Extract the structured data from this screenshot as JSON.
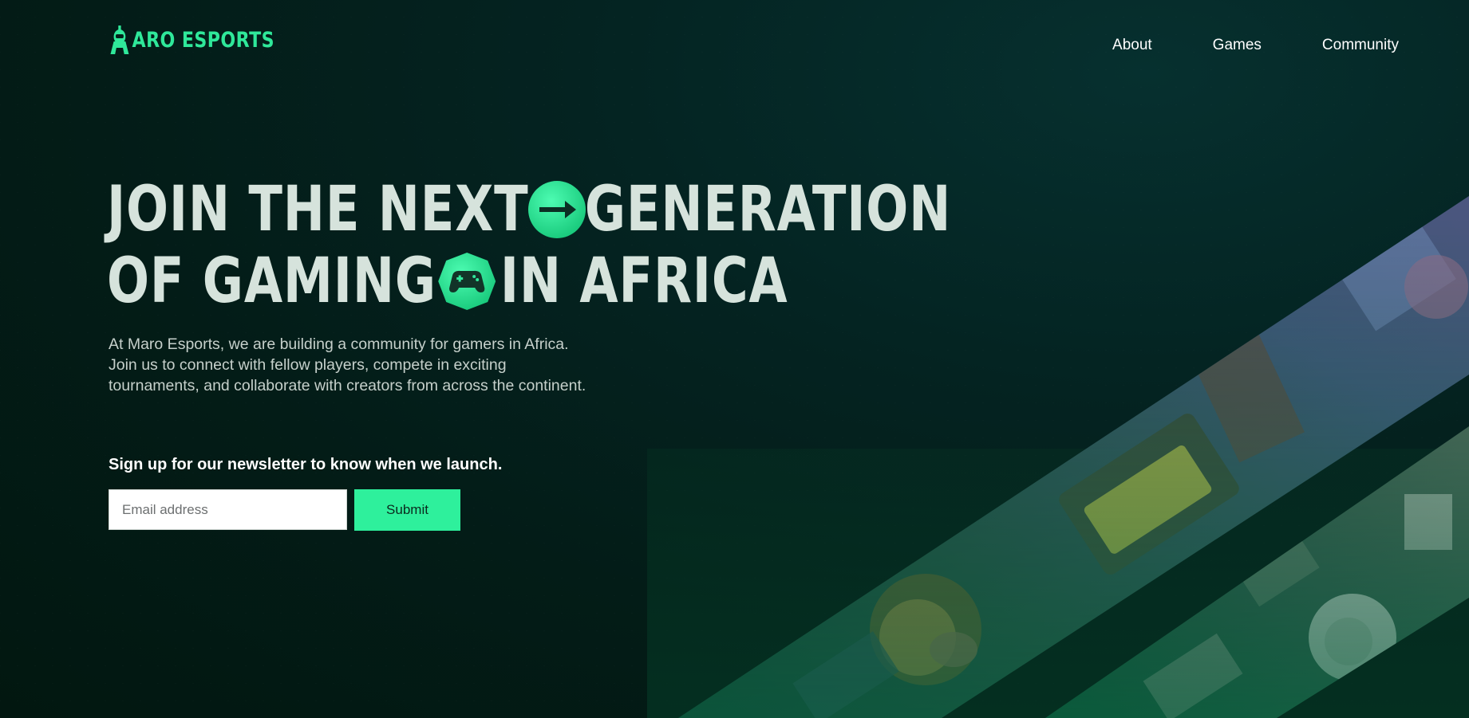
{
  "brand": {
    "name": "ARO ESPORTS",
    "accent_color": "#2fe89a",
    "logo_icon": "astronaut-logo-icon"
  },
  "nav": {
    "items": [
      {
        "label": "About"
      },
      {
        "label": "Games"
      },
      {
        "label": "Community"
      }
    ]
  },
  "hero": {
    "line1_a": "JOIN THE NEXT",
    "line1_b": "GENERATION",
    "line2_a": "OF GAMING",
    "line2_b": "IN AFRICA",
    "arrow_badge_icon": "arrow-right-icon",
    "gamepad_badge_icon": "gamepad-icon",
    "description": "At Maro Esports, we are building a community for gamers in Africa. Join us to connect with fellow players, compete in exciting tournaments, and collaborate with creators from across the continent."
  },
  "newsletter": {
    "label": "Sign up for our newsletter to know when we launch.",
    "email_placeholder": "Email address",
    "email_value": "",
    "submit_label": "Submit"
  },
  "colors": {
    "background": "#031c17",
    "heading": "#d6e3dc",
    "button": "#2ef09c"
  }
}
